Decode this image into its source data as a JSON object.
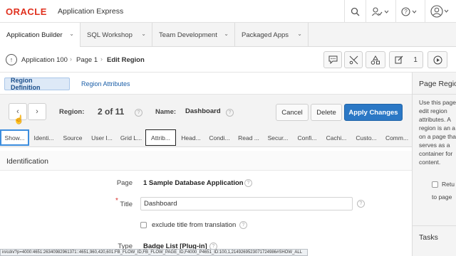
{
  "header": {
    "brand": "ORACLE",
    "product": "Application Express",
    "icons": [
      "search-icon",
      "person-tasks-icon",
      "help-icon",
      "user-avatar-icon"
    ]
  },
  "tabs": [
    {
      "label": "Application Builder"
    },
    {
      "label": "SQL Workshop"
    },
    {
      "label": "Team Development"
    },
    {
      "label": "Packaged Apps"
    }
  ],
  "breadcrumb": {
    "items": [
      "Application 100",
      "Page 1",
      "Edit Region"
    ],
    "page_count": "1"
  },
  "subtabs": {
    "region_definition": "Region Definition",
    "region_attributes": "Region Attributes"
  },
  "toolbar": {
    "region_label": "Region:",
    "region_value": "2 of 11",
    "name_label": "Name:",
    "name_value": "Dashboard",
    "cancel": "Cancel",
    "delete": "Delete",
    "apply": "Apply Changes"
  },
  "section_tabs": [
    "Show...",
    "Identi...",
    "Source",
    "User I...",
    "Grid L...",
    "Attrib...",
    "Head...",
    "Condi...",
    "Read ...",
    "Secur...",
    "Confi...",
    "Cachi...",
    "Custo...",
    "Comm..."
  ],
  "identification": {
    "title": "Identification",
    "page_label": "Page",
    "page_value": "1 Sample Database Application",
    "title_label": "Title",
    "title_value": "Dashboard",
    "exclude_label": "exclude title from translation",
    "type_label": "Type",
    "type_value": "Badge List [Plug-in]"
  },
  "right_panel": {
    "title": "Page Regio",
    "lines": [
      "Use this page",
      "edit region",
      "attributes. A",
      "region is an a",
      "on a page tha",
      "serves as a",
      "container for",
      "content."
    ],
    "checkbox_label": "Retu",
    "checkbox_label2": "to page",
    "tasks": "Tasks"
  },
  "status_url": "in/cdn/?p=4000:4651:26340982961371::4651,960,420,601:FB_FLOW_ID,FB_FLOW_PAGE_ID,F4000_P4651_ID:100,1,2149269523071724986#SHOW_ALL"
}
